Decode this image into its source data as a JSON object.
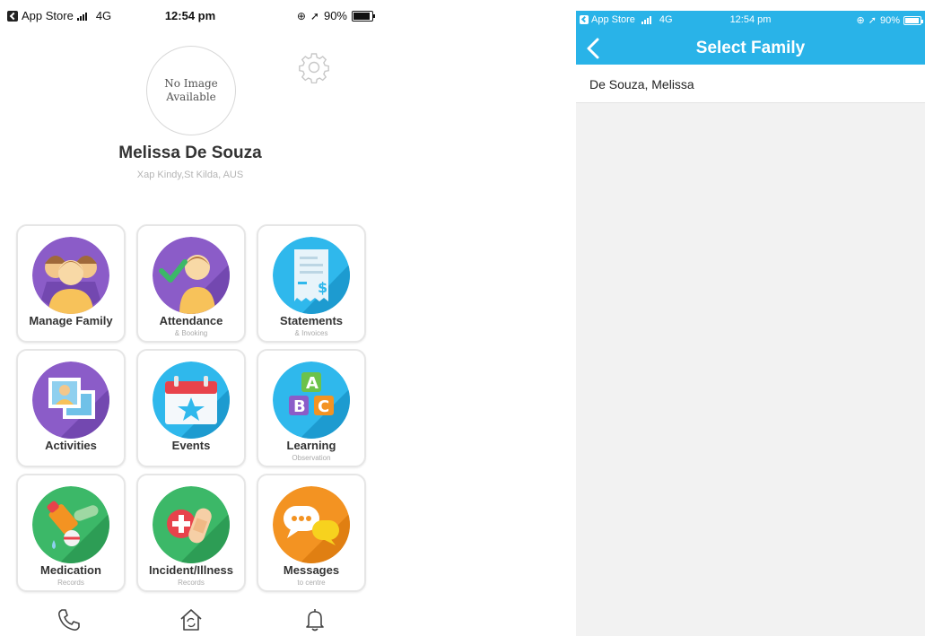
{
  "left_screen": {
    "status_bar": {
      "back_app": "App Store",
      "network": "4G",
      "time": "12:54 pm",
      "battery": "90%"
    },
    "profile": {
      "avatar_placeholder_line1": "No Image",
      "avatar_placeholder_line2": "Available",
      "name": "Melissa De Souza",
      "location": "Xap Kindy,St Kilda, AUS"
    },
    "tiles": [
      {
        "label": "Manage Family",
        "sub": "",
        "icon": "family-icon"
      },
      {
        "label": "Attendance",
        "sub": "& Booking",
        "icon": "attendance-icon"
      },
      {
        "label": "Statements",
        "sub": "& Invoices",
        "icon": "statement-icon"
      },
      {
        "label": "Activities",
        "sub": "",
        "icon": "photos-icon"
      },
      {
        "label": "Events",
        "sub": "",
        "icon": "calendar-icon"
      },
      {
        "label": "Learning",
        "sub": "Observation",
        "icon": "abc-blocks-icon"
      },
      {
        "label": "Medication",
        "sub": "Records",
        "icon": "medication-icon"
      },
      {
        "label": "Incident/Illness",
        "sub": "Records",
        "icon": "first-aid-icon"
      },
      {
        "label": "Messages",
        "sub": "to centre",
        "icon": "chat-bubbles-icon"
      }
    ],
    "bottom_nav": [
      "phone-icon",
      "home-sync-icon",
      "bell-icon"
    ]
  },
  "right_screen": {
    "status_bar": {
      "back_app": "App Store",
      "network": "4G",
      "time": "12:54 pm",
      "battery": "90%"
    },
    "title": "Select Family",
    "families": [
      "De Souza, Melissa"
    ]
  },
  "colors": {
    "header_blue": "#29b3e8",
    "purple": "#8b5cc8",
    "light_blue": "#2fb8ec",
    "green": "#3cb868",
    "orange": "#f39322"
  }
}
